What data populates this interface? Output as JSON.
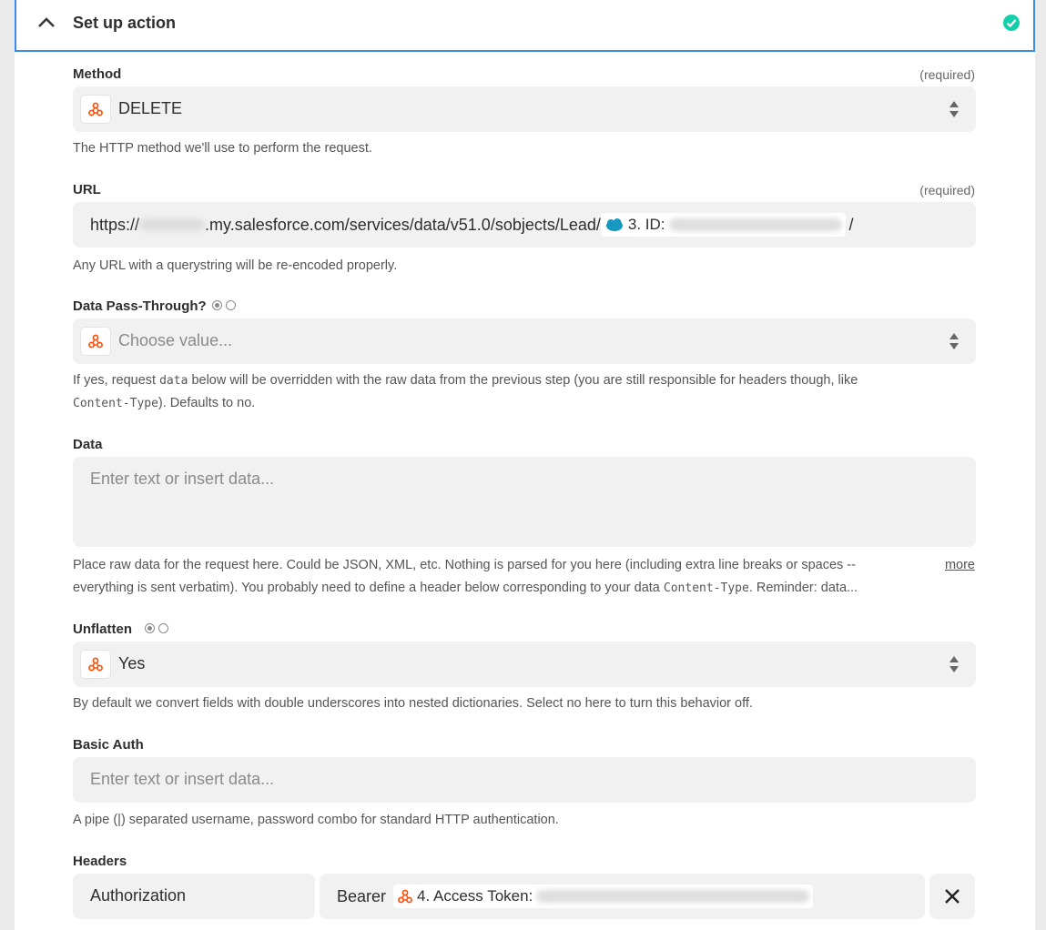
{
  "header": {
    "title": "Set up action"
  },
  "method": {
    "label": "Method",
    "required": "(required)",
    "value": "DELETE",
    "help": "The HTTP method we'll use to perform the request."
  },
  "url": {
    "label": "URL",
    "required": "(required)",
    "prefix": "https://",
    "mid": ".my.salesforce.com/services/data/v51.0/sobjects/Lead/",
    "pill_label": "3. ID:",
    "suffix": "/",
    "help": "Any URL with a querystring will be re-encoded properly."
  },
  "passthrough": {
    "label": "Data Pass-Through?",
    "placeholder": "Choose value...",
    "help_1": "If yes, request ",
    "help_code": "data",
    "help_2": " below will be overridden with the raw data from the previous step (you are still responsible for headers though, like",
    "help_code2": "Content-Type",
    "help_3": "). Defaults to no."
  },
  "data": {
    "label": "Data",
    "placeholder": "Enter text or insert data...",
    "help_1": "Place raw data for the request here. Could be JSON, XML, etc. Nothing is parsed for you here (including extra line breaks or spaces --",
    "help_2": "everything is sent verbatim). You probably need to define a header below corresponding to your data ",
    "help_code": "Content-Type",
    "help_3": ". Reminder: data...",
    "more": "more"
  },
  "unflatten": {
    "label": "Unflatten",
    "value": "Yes",
    "help": "By default we convert fields with double underscores into nested dictionaries. Select no here to turn this behavior off."
  },
  "basic_auth": {
    "label": "Basic Auth",
    "placeholder": "Enter text or insert data...",
    "help": "A pipe (|) separated username, password combo for standard HTTP authentication."
  },
  "headers": {
    "label": "Headers",
    "key": "Authorization",
    "value_prefix": "Bearer",
    "pill_label": "4. Access Token:"
  },
  "colors": {
    "accent": "#3d8af7",
    "success": "#13d0ab",
    "webhook": "#ff4a00"
  }
}
